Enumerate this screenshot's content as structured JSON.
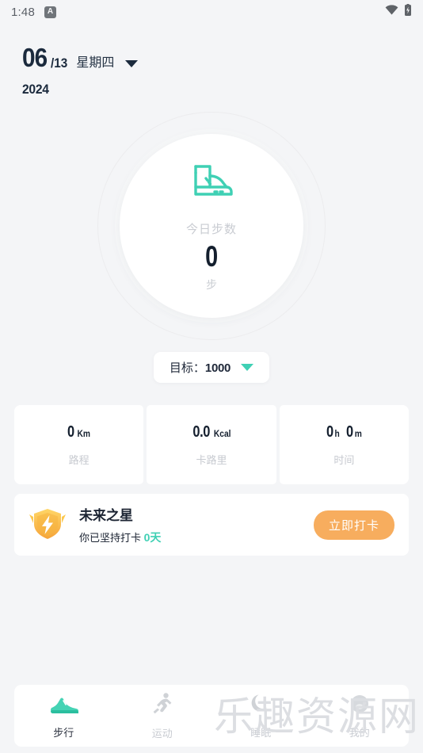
{
  "status_bar": {
    "time": "1:48",
    "app_badge": "A",
    "wifi_icon": "wifi-icon",
    "battery_icon": "battery-charging-icon"
  },
  "header": {
    "day": "06",
    "month_sep": "/13",
    "weekday": "星期四",
    "year": "2024",
    "dropdown_icon": "chevron-down-icon"
  },
  "step_ring": {
    "icon": "shoe-icon",
    "label": "今日步数",
    "value": "0",
    "unit": "步"
  },
  "goal": {
    "label": "目标：",
    "value": "1000",
    "dropdown_icon": "chevron-down-icon"
  },
  "stats": [
    {
      "number": "0",
      "unit": "Km",
      "name": "路程"
    },
    {
      "number": "0.0",
      "unit": "Kcal",
      "name": "卡路里"
    },
    {
      "number": "0",
      "unit": "h",
      "number2": "0",
      "unit2": "m",
      "name": "时间"
    }
  ],
  "checkin": {
    "badge_icon": "shield-lightning-badge-icon",
    "title": "未来之星",
    "sub_prefix": "你已坚持打卡 ",
    "sub_days": "0天",
    "button_label": "立即打卡"
  },
  "bottom_nav": [
    {
      "label": "步行",
      "icon": "sneaker-icon",
      "active": true
    },
    {
      "label": "运动",
      "icon": "running-person-icon",
      "active": false
    },
    {
      "label": "睡眠",
      "icon": "moon-icon",
      "active": false
    },
    {
      "label": "我的",
      "icon": "profile-icon",
      "active": false
    }
  ],
  "watermark": {
    "text": "乐趣资源网"
  },
  "colors": {
    "background": "#f4f5f7",
    "card": "#ffffff",
    "accent_teal": "#3fd0b4",
    "accent_orange": "#f7ad5e",
    "text_dark": "#141f2e",
    "text_muted": "#c9ccd2"
  }
}
